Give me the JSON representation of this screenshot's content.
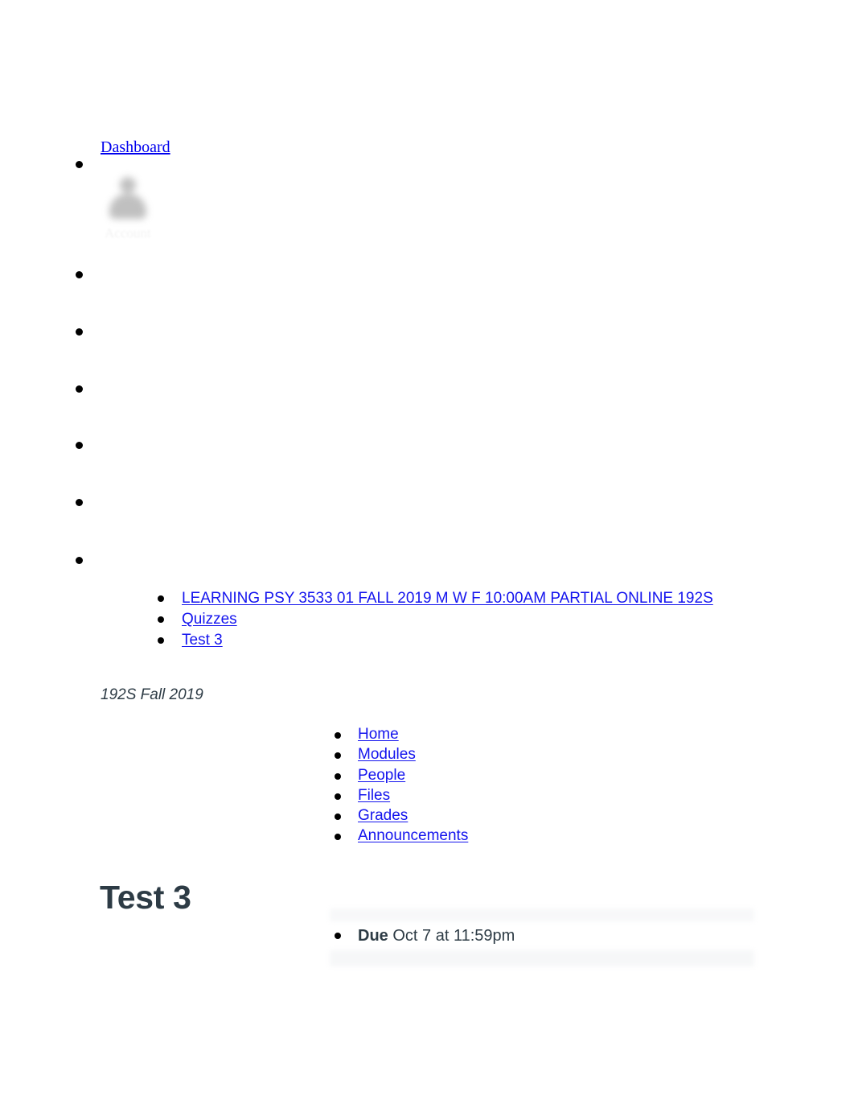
{
  "global_nav": {
    "dashboard_label": "Dashboard",
    "account_label": "Account",
    "avatar_icon": "user-avatar-icon",
    "blank_items": [
      "",
      "",
      "",
      "",
      "",
      ""
    ]
  },
  "breadcrumbs": [
    {
      "label": "LEARNING PSY 3533 01 FALL 2019 M W F 10:00AM PARTIAL ONLINE 192S"
    },
    {
      "label": "Quizzes"
    },
    {
      "label": "Test 3"
    }
  ],
  "course": {
    "term_label": "192S Fall 2019",
    "nav_items": [
      {
        "label": "Home"
      },
      {
        "label": "Modules"
      },
      {
        "label": "People"
      },
      {
        "label": "Files"
      },
      {
        "label": "Grades"
      },
      {
        "label": "Announcements"
      }
    ]
  },
  "page": {
    "title": "Test 3"
  },
  "quiz_meta": {
    "due_label": "Due",
    "due_value": " Oct 7 at 11:59pm"
  },
  "colors": {
    "link": "#1414ee",
    "dashboard_link": "#0000ee",
    "text": "#2d3b45",
    "band": "#f7f8f9"
  }
}
